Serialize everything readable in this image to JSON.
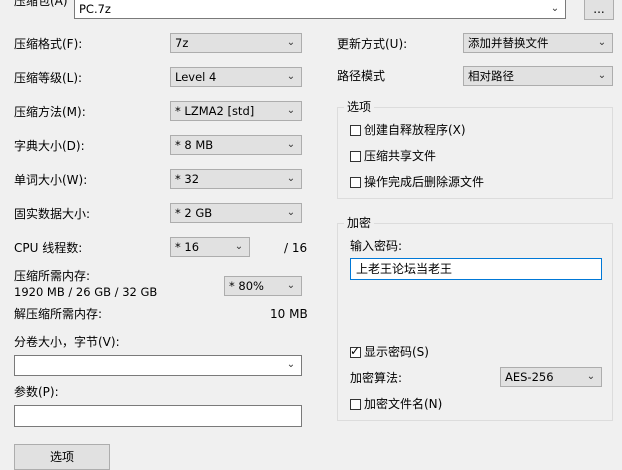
{
  "archive": {
    "label": "压缩包(A)",
    "value": "PC.7z",
    "browse_label": "..."
  },
  "left": {
    "format": {
      "label": "压缩格式(F):",
      "value": "7z"
    },
    "level": {
      "label": "压缩等级(L):",
      "value": "Level 4"
    },
    "method": {
      "label": "压缩方法(M):",
      "value": "* LZMA2 [std]"
    },
    "dict": {
      "label": "字典大小(D):",
      "value": "* 8 MB"
    },
    "word": {
      "label": "单词大小(W):",
      "value": "* 32"
    },
    "solid": {
      "label": "固实数据大小:",
      "value": "* 2 GB"
    },
    "threads": {
      "label": "CPU 线程数:",
      "value": "* 16",
      "max": "/ 16"
    },
    "mem_compress": {
      "label": "压缩所需内存:",
      "detail": "1920 MB / 26 GB / 32 GB",
      "value": "* 80%"
    },
    "mem_decompress": {
      "label": "解压缩所需内存:",
      "value": "10 MB"
    },
    "volume": {
      "label": "分卷大小，字节(V):",
      "value": ""
    },
    "params": {
      "label": "参数(P):",
      "value": ""
    },
    "options_button": "选项"
  },
  "right": {
    "update": {
      "label": "更新方式(U):",
      "value": "添加并替换文件"
    },
    "path": {
      "label": "路径模式",
      "value": "相对路径"
    },
    "options_group": {
      "title": "选项",
      "sfx": {
        "label": "创建自释放程序(X)",
        "checked": false
      },
      "shared": {
        "label": "压缩共享文件",
        "checked": false
      },
      "delete": {
        "label": "操作完成后删除源文件",
        "checked": false
      }
    },
    "encryption": {
      "title": "加密",
      "password_label": "输入密码:",
      "password_value": "上老王论坛当老王",
      "show_password": {
        "label": "显示密码(S)",
        "checked": true
      },
      "method_label": "加密算法:",
      "method_value": "AES-256",
      "encrypt_names": {
        "label": "加密文件名(N)",
        "checked": false
      }
    }
  }
}
